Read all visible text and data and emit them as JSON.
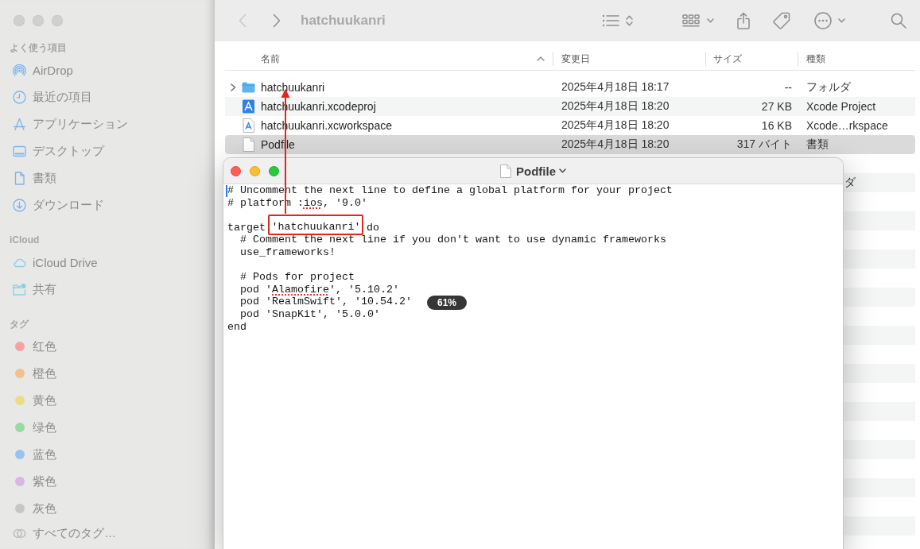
{
  "sidebar": {
    "sections": [
      {
        "title": "よく使う項目",
        "items": [
          {
            "kind": "airdrop",
            "label": "AirDrop",
            "selected": false
          },
          {
            "kind": "recents",
            "label": "最近の項目",
            "selected": false
          },
          {
            "kind": "applications",
            "label": "アプリケーション",
            "selected": false
          },
          {
            "kind": "desktop",
            "label": "デスクトップ",
            "selected": false
          },
          {
            "kind": "documents",
            "label": "書類",
            "selected": false
          },
          {
            "kind": "downloads",
            "label": "ダウンロード",
            "selected": false
          }
        ]
      },
      {
        "title": "iCloud",
        "items": [
          {
            "kind": "icloud",
            "label": "iCloud Drive",
            "selected": false
          },
          {
            "kind": "shared",
            "label": "共有",
            "selected": false
          }
        ]
      },
      {
        "title": "タグ",
        "items": [
          {
            "kind": "tag",
            "label": "红色",
            "color": "#f5a4a2",
            "selected": false
          },
          {
            "kind": "tag",
            "label": "橙色",
            "color": "#f2c18f",
            "selected": false
          },
          {
            "kind": "tag",
            "label": "黄色",
            "color": "#efd98a",
            "selected": false
          },
          {
            "kind": "tag",
            "label": "绿色",
            "color": "#97dba3",
            "selected": false
          },
          {
            "kind": "tag",
            "label": "蓝色",
            "color": "#98c3f1",
            "selected": false
          },
          {
            "kind": "tag",
            "label": "紫色",
            "color": "#dab5e6",
            "selected": false
          },
          {
            "kind": "tag",
            "label": "灰色",
            "color": "#c6c6c6",
            "selected": false
          },
          {
            "kind": "all-tags",
            "label": "すべてのタグ…",
            "selected": false
          }
        ]
      }
    ]
  },
  "toolbar": {
    "back": {
      "disabled": true
    },
    "forward": {
      "disabled": false
    },
    "title": "hatchuukanri"
  },
  "file_list": {
    "columns": [
      {
        "label": "名前",
        "sorted": true
      },
      {
        "label": "変更日",
        "sorted": false
      },
      {
        "label": "サイズ",
        "sorted": false
      },
      {
        "label": "種類",
        "sorted": false
      }
    ],
    "rows": [
      {
        "kind": "folder",
        "name": "hatchuukanri",
        "modified": "2025年4月18日 18:17",
        "size": "--",
        "type": "フォルダ",
        "expanded": false,
        "selected": false
      },
      {
        "kind": "project",
        "name": "hatchuukanri.xcodeproj",
        "modified": "2025年4月18日 18:20",
        "size": "27 KB",
        "type": "Xcode Project",
        "selected": false
      },
      {
        "kind": "workspace",
        "name": "hatchuukanri.xcworkspace",
        "modified": "2025年4月18日 18:20",
        "size": "16 KB",
        "type": "Xcode…rkspace",
        "selected": false
      },
      {
        "kind": "document",
        "name": "Podfile",
        "modified": "2025年4月18日 18:20",
        "size": "317 バイト",
        "type": "書類",
        "selected": true
      }
    ],
    "covered_row": {
      "type": "ダ"
    }
  },
  "editor": {
    "title": "Podfile",
    "zoom_level": "61%",
    "lines": [
      {
        "kind": "text",
        "segments": [
          {
            "text": "# Uncomment the next line to define a global platform for your project",
            "misspelled": false,
            "highlighted": false
          }
        ]
      },
      {
        "kind": "text",
        "segments": [
          {
            "text": "# platform :",
            "misspelled": false,
            "highlighted": false
          },
          {
            "text": "ios",
            "misspelled": true,
            "highlighted": false
          },
          {
            "text": ", '9.0'",
            "misspelled": false,
            "highlighted": false
          }
        ]
      },
      {
        "kind": "blank"
      },
      {
        "kind": "text",
        "segments": [
          {
            "text": "target ",
            "misspelled": false,
            "highlighted": false
          },
          {
            "text": "'hatchuukanri'",
            "misspelled": false,
            "highlighted": true
          },
          {
            "text": " do",
            "misspelled": false,
            "highlighted": false
          }
        ]
      },
      {
        "kind": "text",
        "segments": [
          {
            "text": "  # Comment the next line if you don't want to use dynamic frameworks",
            "misspelled": false,
            "highlighted": false
          }
        ]
      },
      {
        "kind": "text",
        "segments": [
          {
            "text": "  use_frameworks!",
            "misspelled": false,
            "highlighted": false
          }
        ]
      },
      {
        "kind": "blank"
      },
      {
        "kind": "text",
        "segments": [
          {
            "text": "  # Pods for project",
            "misspelled": false,
            "highlighted": false
          }
        ]
      },
      {
        "kind": "text",
        "segments": [
          {
            "text": "  pod '",
            "misspelled": false,
            "highlighted": false
          },
          {
            "text": "Alamofire",
            "misspelled": true,
            "highlighted": false
          },
          {
            "text": "', '5.10.2'",
            "misspelled": false,
            "highlighted": false
          }
        ]
      },
      {
        "kind": "text",
        "segments": [
          {
            "text": "  pod 'RealmSwift', '10.54.2'",
            "misspelled": false,
            "highlighted": false
          }
        ]
      },
      {
        "kind": "text",
        "segments": [
          {
            "text": "  pod 'SnapKit', '5.0.0'",
            "misspelled": false,
            "highlighted": false
          }
        ]
      },
      {
        "kind": "text",
        "segments": [
          {
            "text": "end",
            "misspelled": false,
            "highlighted": false
          }
        ]
      }
    ]
  }
}
